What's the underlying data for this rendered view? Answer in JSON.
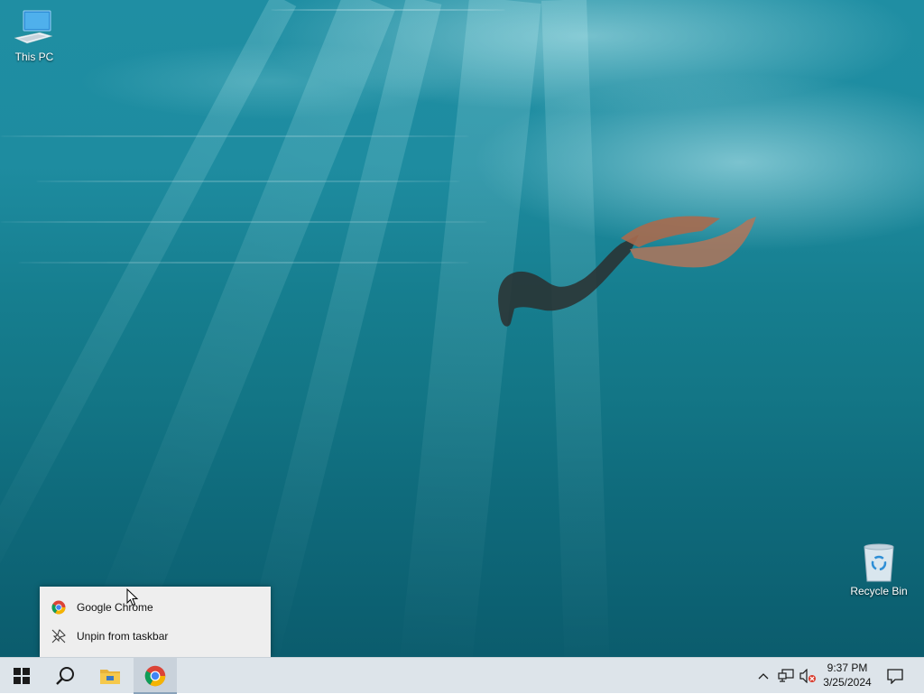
{
  "desktop": {
    "icons": [
      {
        "label": "This PC",
        "icon": "this-pc-icon"
      },
      {
        "label": "Recycle Bin",
        "icon": "recycle-bin-icon"
      }
    ]
  },
  "jumplist": {
    "items": [
      {
        "label": "Google Chrome",
        "icon": "chrome-icon"
      },
      {
        "label": "Unpin from taskbar",
        "icon": "unpin-icon"
      }
    ]
  },
  "taskbar": {
    "buttons": [
      {
        "name": "start",
        "icon": "windows-logo-icon"
      },
      {
        "name": "search",
        "icon": "search-icon"
      },
      {
        "name": "file-explorer",
        "icon": "folder-icon"
      },
      {
        "name": "google-chrome",
        "icon": "chrome-icon",
        "active": true
      }
    ],
    "tray": {
      "icons": [
        "chevron-up-icon",
        "network-icon",
        "volume-muted-icon",
        "notification-icon"
      ],
      "time": "9:37 PM",
      "date": "3/25/2024"
    }
  },
  "colors": {
    "taskbar_bg": "#dde4ea",
    "jumplist_bg": "#eeeeee",
    "water_top": "#1f8ea3",
    "water_bottom": "#0b5c6d"
  }
}
